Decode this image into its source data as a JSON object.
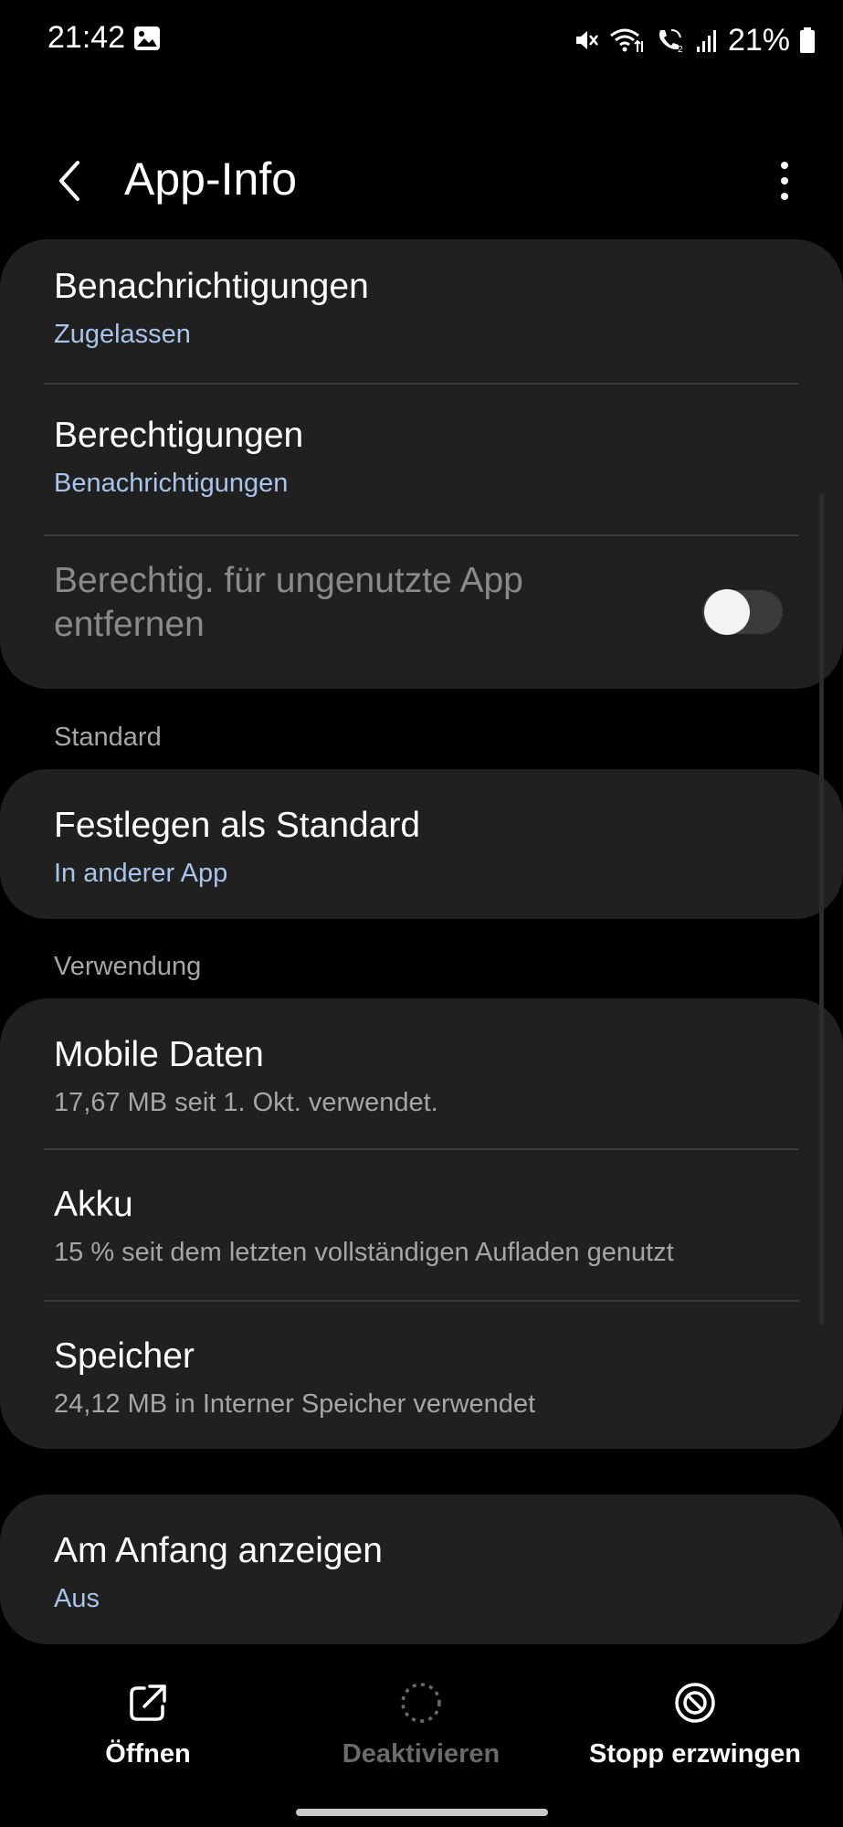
{
  "status_bar": {
    "time": "21:42",
    "battery": "21%",
    "icons": [
      "gallery-icon",
      "mute-icon",
      "wifi-icon",
      "wifi-calling-icon",
      "signal-icon",
      "battery-icon"
    ]
  },
  "header": {
    "title": "App-Info",
    "icons": [
      "back-arrow-icon",
      "more-vertical-icon"
    ]
  },
  "permissions_card": {
    "notifications": {
      "title": "Benachrichtigungen",
      "subtitle": "Zugelassen"
    },
    "permissions": {
      "title": "Berechtigungen",
      "subtitle": "Benachrichtigungen"
    },
    "remove_unused": {
      "title_line1": "Berechtig. für ungenutzte App",
      "title_line2": "entfernen",
      "toggle_on": false
    }
  },
  "standard_section": {
    "label": "Standard",
    "set_default": {
      "title": "Festlegen als Standard",
      "subtitle": "In anderer App"
    }
  },
  "usage_section": {
    "label": "Verwendung",
    "mobile_data": {
      "title": "Mobile Daten",
      "subtitle": "17,67 MB seit 1. Okt. verwendet."
    },
    "battery": {
      "title": "Akku",
      "subtitle": "15 % seit dem letzten vollständigen Aufladen genutzt"
    },
    "storage": {
      "title": "Speicher",
      "subtitle": "24,12 MB in Interner Speicher verwendet"
    }
  },
  "top_card": {
    "show_on_top": {
      "title": "Am Anfang anzeigen",
      "subtitle": "Aus"
    }
  },
  "bottom_actions": {
    "open": {
      "label": "Öffnen",
      "icon": "open-external-icon"
    },
    "disable": {
      "label": "Deaktivieren",
      "icon": "dashed-circle-icon",
      "enabled": false
    },
    "force_stop": {
      "label": "Stopp erzwingen",
      "icon": "stop-circle-icon"
    }
  },
  "colors": {
    "background": "#000000",
    "card": "#202020",
    "accent_text": "#a9c4ea",
    "secondary_text": "#a6a6a6",
    "disabled_text": "#6a6a6a"
  }
}
